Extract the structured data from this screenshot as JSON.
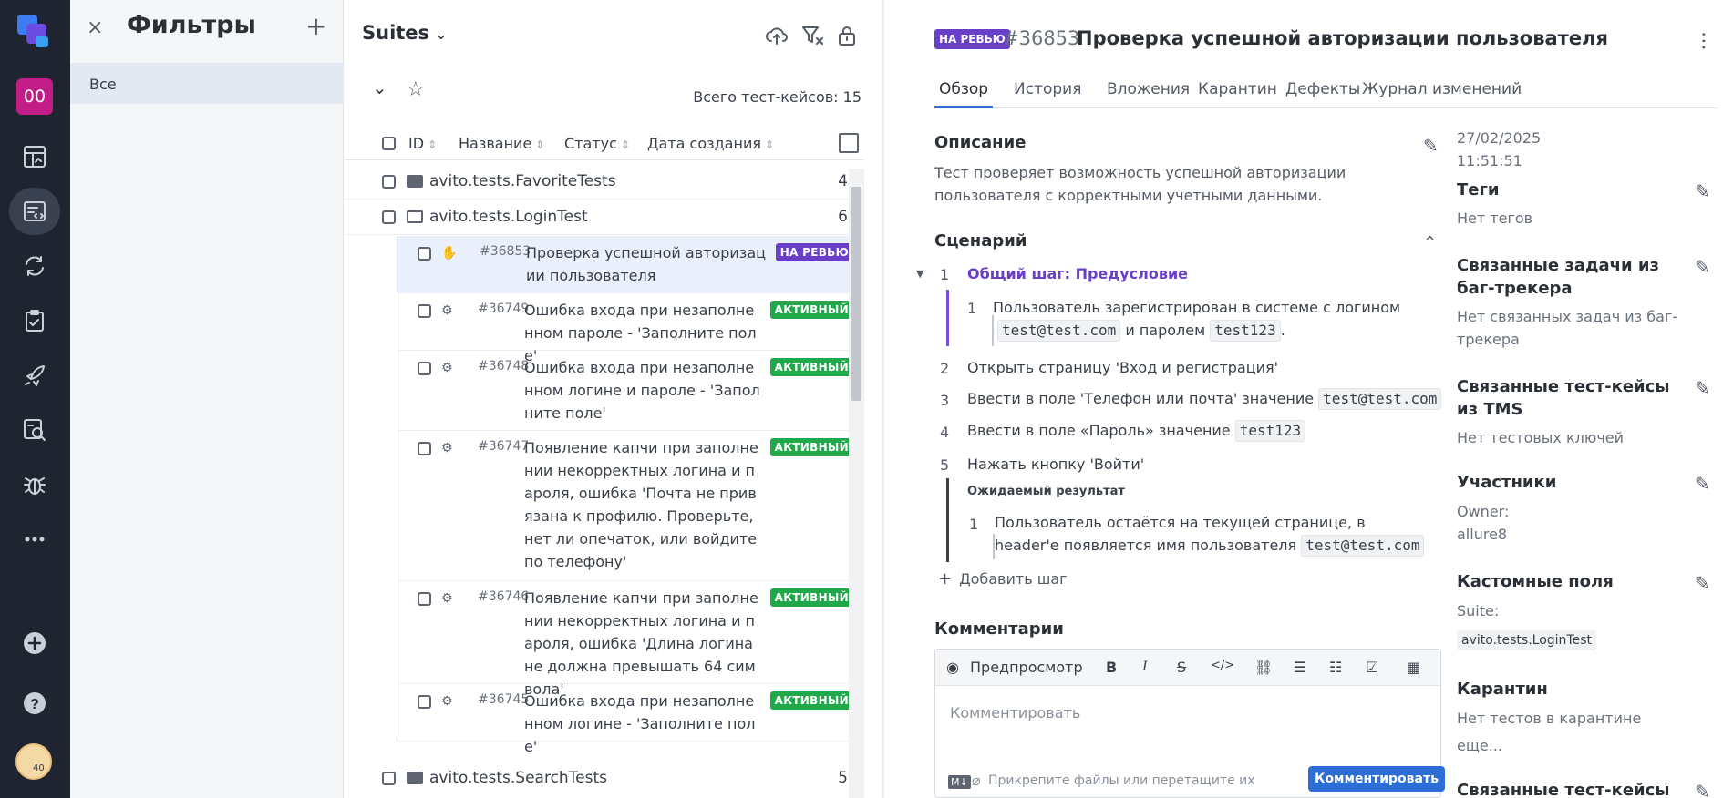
{
  "rail": {
    "project_badge": "00",
    "items": [
      "dashboard-icon",
      "testcases-icon",
      "launches-icon",
      "testplans-icon",
      "jobs-icon",
      "analytics-icon",
      "defects-icon",
      "more-icon"
    ],
    "bottom": [
      "add-icon",
      "help-icon"
    ],
    "avatar_text": "40"
  },
  "filters": {
    "close_label": "×",
    "title": "Фильтры",
    "add_label": "+",
    "items": [
      {
        "label": "Все"
      }
    ]
  },
  "tree": {
    "suites_label": "Suites",
    "total_label": "Всего тест-кейсов: 15",
    "columns": {
      "id": "ID",
      "name": "Название",
      "status": "Статус",
      "created": "Дата создания"
    },
    "folders": [
      {
        "name": "avito.tests.FavoriteTests",
        "count": "4"
      },
      {
        "name": "avito.tests.LoginTest",
        "count": "6"
      },
      {
        "name": "avito.tests.SearchTests",
        "count": "5"
      }
    ],
    "cases": [
      {
        "id": "#36853",
        "name": "Проверка успешной авторизации пользователя",
        "status": "НА РЕВЬЮ"
      },
      {
        "id": "#36749",
        "name": "Ошибка входа при незаполненном пароле - 'Заполните поле'",
        "status": "АКТИВНЫЙ"
      },
      {
        "id": "#36748",
        "name": "Ошибка входа при незаполненном логине и пароле - 'Заполните поле'",
        "status": "АКТИВНЫЙ"
      },
      {
        "id": "#36747",
        "name": "Появление капчи при заполнении некорректных логина и пароля, ошибка 'Почта не привязана к профилю. Проверьте, нет ли опечаток, или войдите по телефону'",
        "status": "АКТИВНЫЙ"
      },
      {
        "id": "#36746",
        "name": "Появление капчи при заполнении некорректных логина и пароля, ошибка 'Длина логина не должна превышать 64 символа'",
        "status": "АКТИВНЫЙ"
      },
      {
        "id": "#36745",
        "name": "Ошибка входа при незаполненном логине - 'Заполните поле'",
        "status": "АКТИВНЫЙ"
      }
    ]
  },
  "detail": {
    "status_badge": "НА РЕВЬЮ",
    "id": "#36853",
    "title": "Проверка успешной авторизации пользователя",
    "tabs": [
      "Обзор",
      "История",
      "Вложения",
      "Карантин",
      "Дефекты",
      "Журнал изменений"
    ],
    "description_title": "Описание",
    "description_text": "Тест проверяет возможность успешной авторизации пользователя с корректными учетными данными.",
    "scenario_title": "Сценарий",
    "shared_step": {
      "num": "1",
      "label": "Общий шаг: Предусловие"
    },
    "sub_step": {
      "num": "1",
      "text_before": "Пользователь зарегистрирован в системе с логином",
      "code1": "test@test.com",
      "mid": "и паролем",
      "code2": "test123",
      "after": "."
    },
    "steps": [
      {
        "num": "2",
        "text": "Открыть страницу 'Вход и регистрация'",
        "code": ""
      },
      {
        "num": "3",
        "text": "Ввести в поле 'Телефон или почта' значение",
        "code": "test@test.com"
      },
      {
        "num": "4",
        "text": "Ввести в поле «Пароль» значение",
        "code": "test123"
      },
      {
        "num": "5",
        "text": "Нажать кнопку 'Войти'",
        "code": ""
      }
    ],
    "expected_title": "Ожидаемый результат",
    "expected": {
      "num": "1",
      "text": "Пользователь остаётся на текущей странице, в header'е появляется имя пользователя",
      "code": "test@test.com"
    },
    "add_step": "Добавить шаг",
    "comments_title": "Комментарии",
    "editor": {
      "preview": "Предпросмотр",
      "placeholder": "Комментировать",
      "md_label": "M↓",
      "attach": "Прикрепите файлы или перетащите их",
      "submit": "Комментировать"
    }
  },
  "meta": {
    "date": "27/02/2025",
    "time": "11:51:51",
    "tags_title": "Теги",
    "tags_value": "Нет тегов",
    "issues_title": "Связанные задачи из баг-трекера",
    "issues_value": "Нет связанных задач из баг-трекера",
    "tms_title": "Связанные тест-кейсы из TMS",
    "tms_value": "Нет тестовых ключей",
    "members_title": "Участники",
    "owner_label": "Owner:",
    "owner_value": "allure8",
    "custom_title": "Кастомные поля",
    "suite_label": "Suite:",
    "suite_value": "avito.tests.LoginTest",
    "quarantine_title": "Карантин",
    "quarantine_value": "Нет тестов в карантине",
    "more": "еще...",
    "related_cut": "Связанные тест-кейсы"
  }
}
